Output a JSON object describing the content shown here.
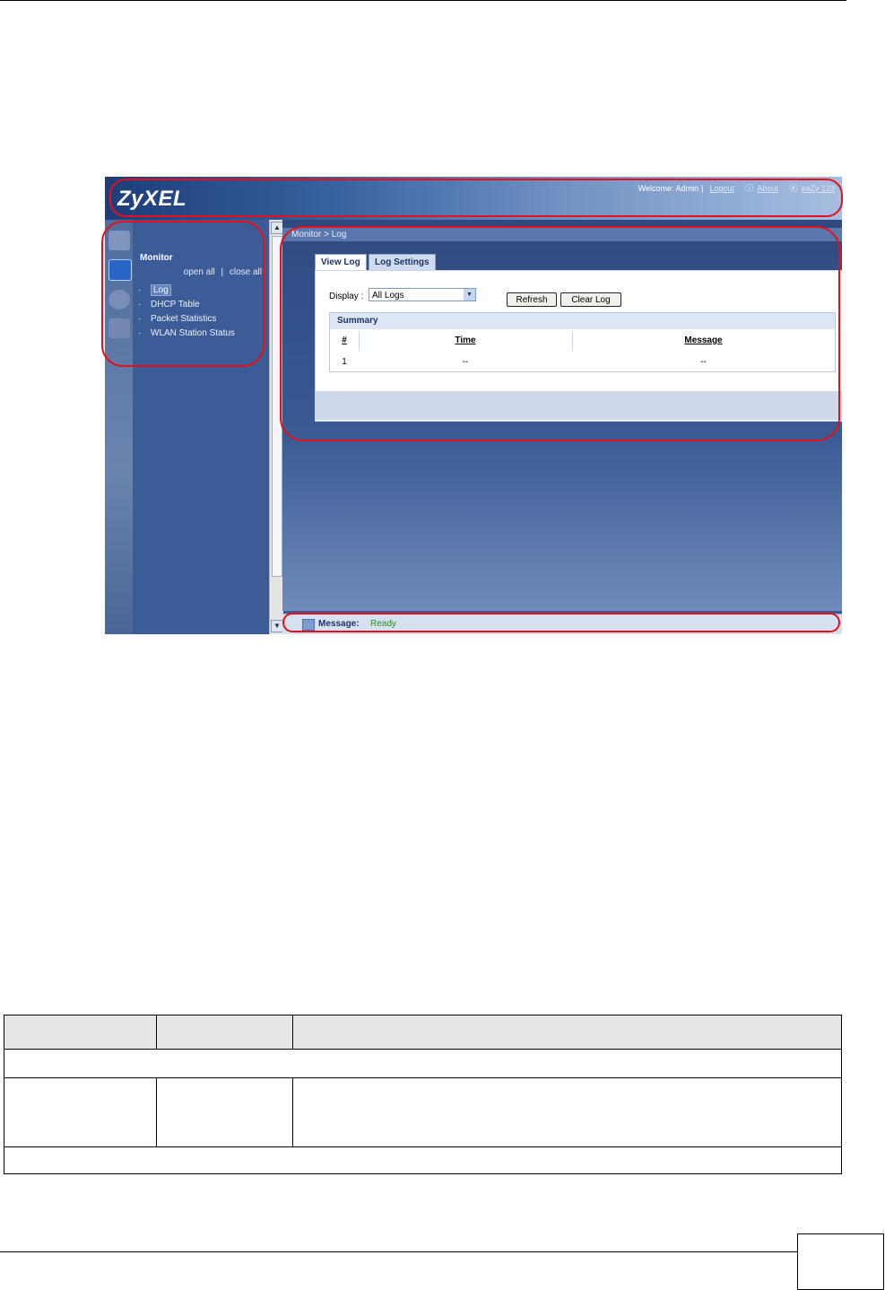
{
  "app": {
    "logo": "ZyXEL",
    "welcome": "Welcome: Admin",
    "logout": "Logout",
    "about": "About",
    "eazy": "eaZy 123"
  },
  "nav": {
    "title": "Monitor",
    "open_all": "open all",
    "close_all": "close all",
    "separator": "|",
    "items": [
      {
        "label": "Log"
      },
      {
        "label": "DHCP Table"
      },
      {
        "label": "Packet Statistics"
      },
      {
        "label": "WLAN Station Status"
      }
    ]
  },
  "main": {
    "breadcrumb": "Monitor > Log",
    "tabs": [
      {
        "label": "View Log"
      },
      {
        "label": "Log Settings"
      }
    ],
    "display_label": "Display :",
    "display_value": "All Logs",
    "buttons": {
      "refresh": "Refresh",
      "clear": "Clear Log"
    },
    "summary": {
      "title": "Summary",
      "columns": [
        "#",
        "Time",
        "Message"
      ],
      "rows": [
        [
          "1",
          "--",
          "--"
        ]
      ]
    }
  },
  "statusbar": {
    "label": "Message:",
    "value": "Ready"
  },
  "colors": {
    "annotation": "#e4101a",
    "brand": "#1d3d78"
  }
}
